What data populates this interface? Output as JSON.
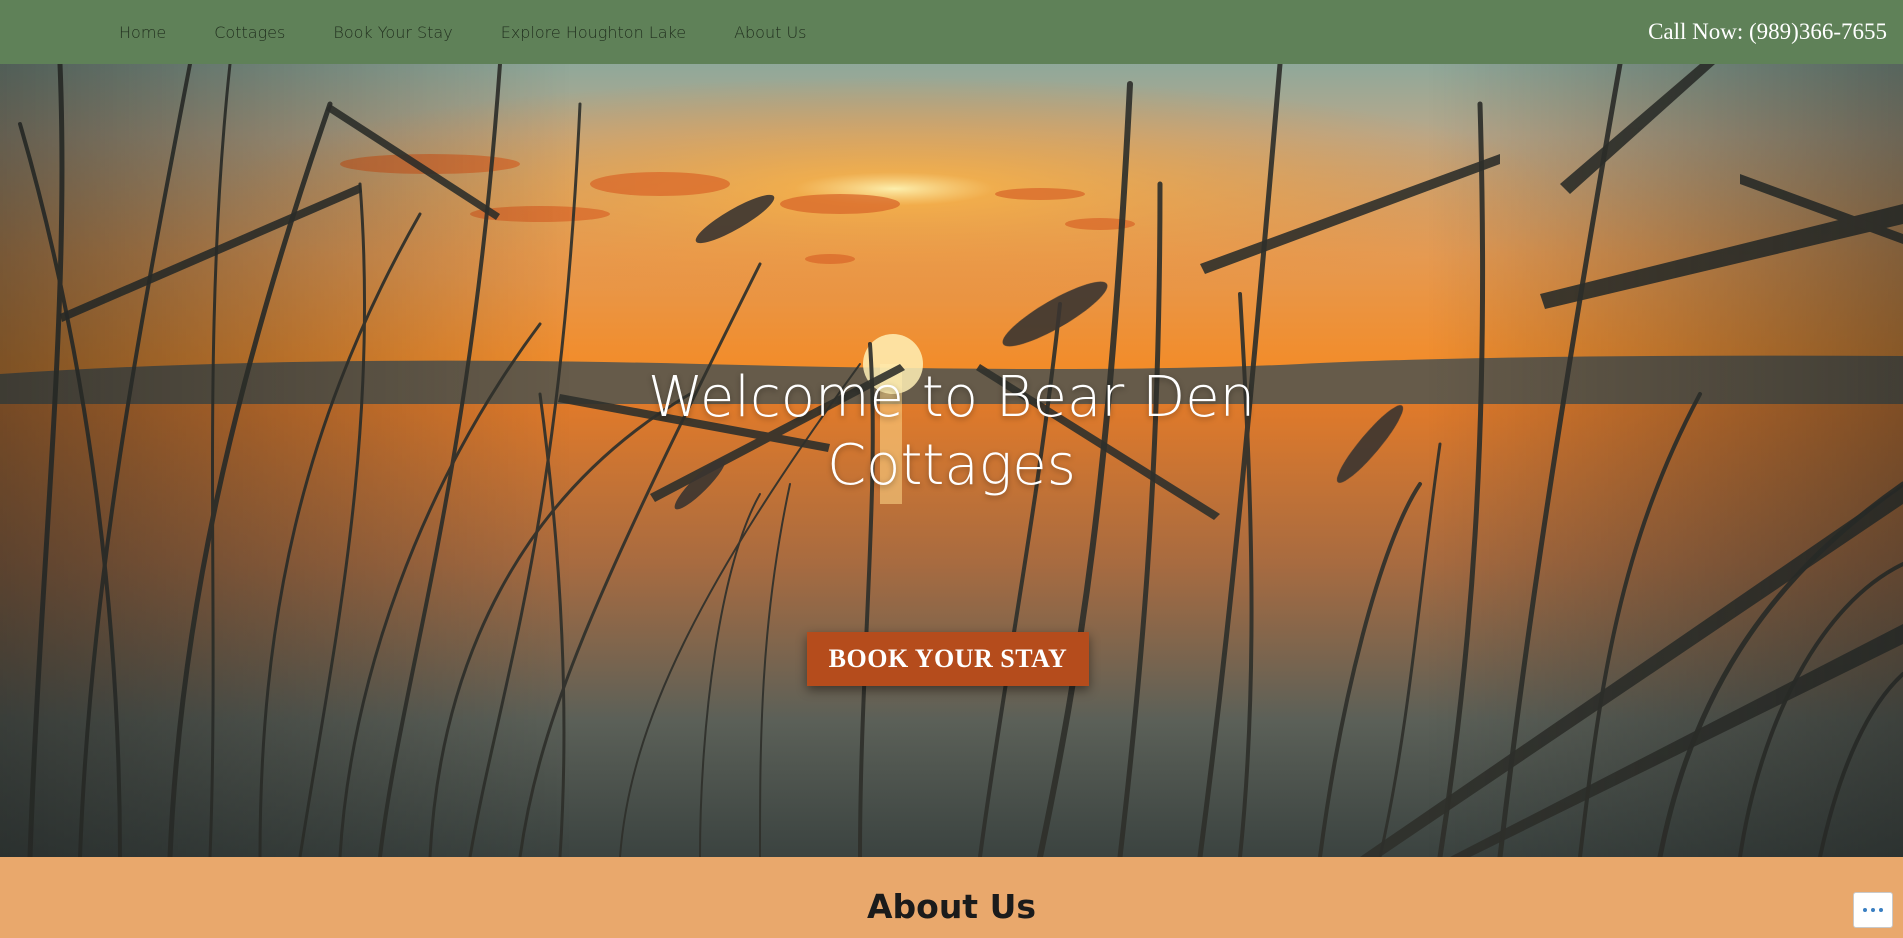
{
  "nav": {
    "items": [
      {
        "label": "Home"
      },
      {
        "label": "Cottages"
      },
      {
        "label": "Book Your Stay"
      },
      {
        "label": "Explore Houghton Lake"
      },
      {
        "label": "About Us"
      }
    ],
    "phone": "Call Now: (989)366-7655"
  },
  "hero": {
    "title_line1": "Welcome to Bear Den",
    "title_line2": "Cottages",
    "button_label": "BOOK YOUR STAY"
  },
  "about": {
    "title": "About Us"
  },
  "widget": {
    "more_icon": "ellipsis-icon"
  },
  "colors": {
    "nav_bg": "#5f8158",
    "button_bg": "#b54c1c",
    "about_bg": "#e9a86c"
  }
}
